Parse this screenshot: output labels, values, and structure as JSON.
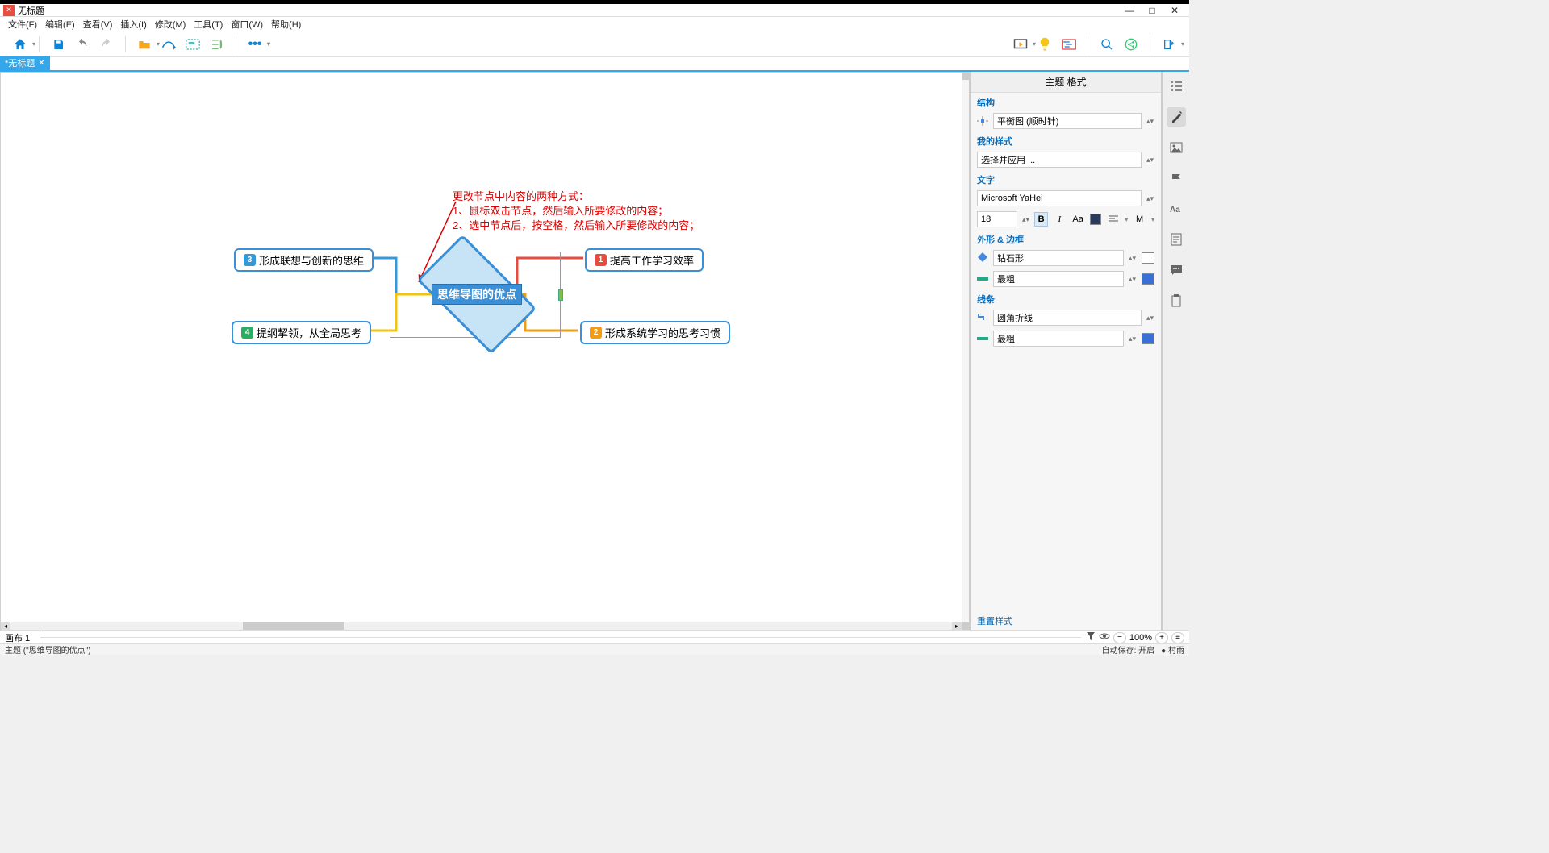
{
  "window": {
    "title": "无标题"
  },
  "window_controls": {
    "min": "—",
    "max": "□",
    "close": "✕"
  },
  "menu": [
    "文件(F)",
    "编辑(E)",
    "查看(V)",
    "插入(I)",
    "修改(M)",
    "工具(T)",
    "窗口(W)",
    "帮助(H)"
  ],
  "doctab": {
    "label": "*无标题",
    "close": "✕"
  },
  "annotation": {
    "line1": "更改节点中内容的两种方式：",
    "line2": "1、鼠标双击节点，然后输入所要修改的内容；",
    "line3": "2、选中节点后，按空格，然后输入所要修改的内容；"
  },
  "mindmap": {
    "center": "思维导图的优点",
    "n1": {
      "num": "1",
      "text": "提高工作学习效率"
    },
    "n2": {
      "num": "2",
      "text": "形成系统学习的思考习惯"
    },
    "n3": {
      "num": "3",
      "text": "形成联想与创新的思维"
    },
    "n4": {
      "num": "4",
      "text": "提纲挈领，从全局思考"
    }
  },
  "panel": {
    "title": "主题 格式",
    "structure_h": "结构",
    "structure_val": "平衡图 (顺时针)",
    "mystyle_h": "我的样式",
    "mystyle_val": "选择并应用 ...",
    "text_h": "文字",
    "font_family": "Microsoft YaHei",
    "font_size": "18",
    "font_B": "B",
    "font_I": "I",
    "font_Aa": "Aa",
    "font_M": "M",
    "shape_h": "外形 & 边框",
    "shape_val": "钻石形",
    "shape_thick": "最粗",
    "line_h": "线条",
    "line_val": "圆角折线",
    "line_thick": "最粗",
    "reset": "重置样式"
  },
  "bottom": {
    "sheet": "画布 1",
    "zoom": "100%",
    "status": "主题 (\"思维导图的优点\")",
    "autosave": "自动保存: 开启",
    "author": "● 村雨"
  }
}
